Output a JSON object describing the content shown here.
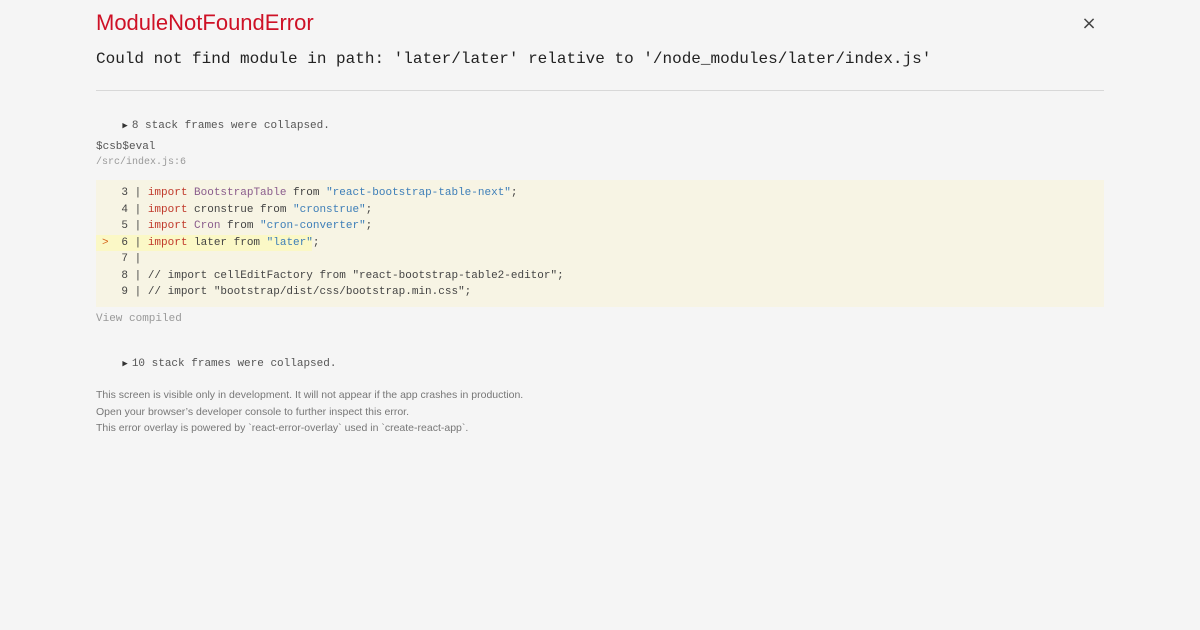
{
  "header": {
    "title": "ModuleNotFoundError",
    "close_icon": "×",
    "message": "Could not find module in path: 'later/later' relative to '/node_modules/later/index.js'"
  },
  "stack": {
    "collapsed_top": "8 stack frames were collapsed.",
    "frame": {
      "name": "$csb$eval",
      "location": "/src/index.js:6"
    },
    "code_lines": [
      {
        "marker": "",
        "num": "3",
        "parts": [
          {
            "t": "import",
            "c": "kw"
          },
          {
            "t": " ",
            "c": "plain"
          },
          {
            "t": "BootstrapTable",
            "c": "id"
          },
          {
            "t": " from ",
            "c": "plain"
          },
          {
            "t": "\"react-bootstrap-table-next\"",
            "c": "str"
          },
          {
            "t": ";",
            "c": "plain"
          }
        ]
      },
      {
        "marker": "",
        "num": "4",
        "parts": [
          {
            "t": "import",
            "c": "kw"
          },
          {
            "t": " cronstrue from ",
            "c": "plain"
          },
          {
            "t": "\"cronstrue\"",
            "c": "str"
          },
          {
            "t": ";",
            "c": "plain"
          }
        ]
      },
      {
        "marker": "",
        "num": "5",
        "parts": [
          {
            "t": "import",
            "c": "kw"
          },
          {
            "t": " ",
            "c": "plain"
          },
          {
            "t": "Cron",
            "c": "id"
          },
          {
            "t": " from ",
            "c": "plain"
          },
          {
            "t": "\"cron-converter\"",
            "c": "str"
          },
          {
            "t": ";",
            "c": "plain"
          }
        ]
      },
      {
        "marker": ">",
        "num": "6",
        "highlight": true,
        "parts": [
          {
            "t": "import",
            "c": "kw"
          },
          {
            "t": " later from ",
            "c": "plain"
          },
          {
            "t": "\"later\"",
            "c": "str"
          },
          {
            "t": ";",
            "c": "plain"
          }
        ]
      },
      {
        "marker": "",
        "num": "7",
        "parts": []
      },
      {
        "marker": "",
        "num": "8",
        "parts": [
          {
            "t": "// import cellEditFactory from \"react-bootstrap-table2-editor\";",
            "c": "plain"
          }
        ]
      },
      {
        "marker": "",
        "num": "9",
        "parts": [
          {
            "t": "// import \"bootstrap/dist/css/bootstrap.min.css\";",
            "c": "plain"
          }
        ]
      }
    ],
    "view_compiled": "View compiled",
    "collapsed_bottom": "10 stack frames were collapsed."
  },
  "footer": {
    "line1": "This screen is visible only in development. It will not appear if the app crashes in production.",
    "line2": "Open your browser’s developer console to further inspect this error.",
    "line3": "This error overlay is powered by `react-error-overlay` used in `create-react-app`."
  },
  "colors": {
    "title": "#ce1126",
    "keyword": "#c0392b",
    "identifier": "#8a5c8c",
    "string": "#3d7eb8",
    "code_background": "#f7f4e4",
    "highlight_background": "#fbf8c6"
  }
}
